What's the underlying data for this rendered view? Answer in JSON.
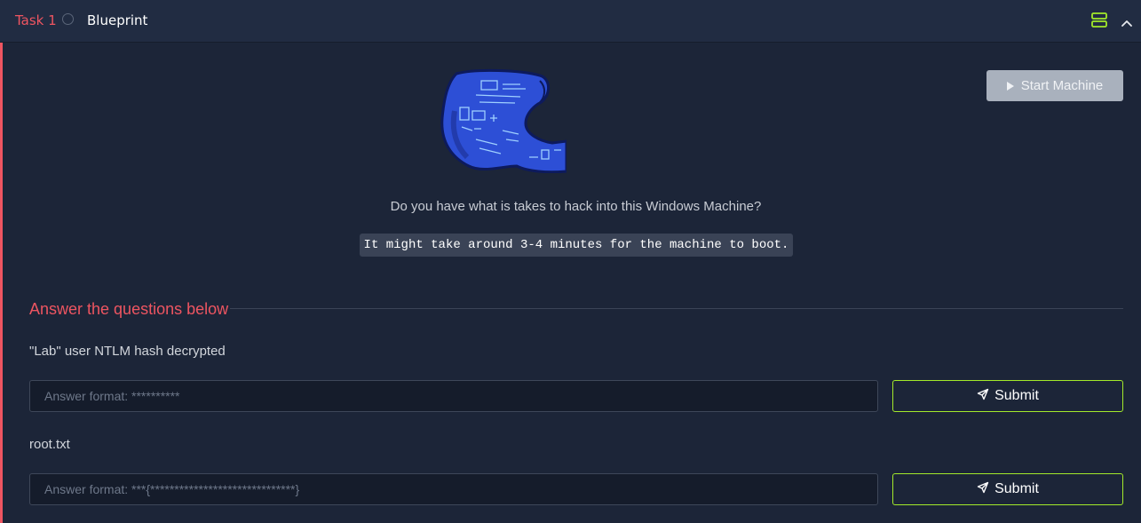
{
  "task": {
    "number_label": "Task 1",
    "title": "Blueprint"
  },
  "header_icons": {
    "vm": "server-stack-icon",
    "toggle": "chevron-up-icon"
  },
  "machine": {
    "start_label": "Start Machine",
    "image": "blueprint-scroll-illustration"
  },
  "content": {
    "description": "Do you have what is takes to hack into this Windows Machine?",
    "boot_note": "It might take around 3-4 minutes for the machine to boot."
  },
  "questions_heading": "Answer the questions below",
  "questions": [
    {
      "label": "\"Lab\" user NTLM hash decrypted",
      "placeholder": "Answer format: **********",
      "value": "",
      "submit_label": "Submit"
    },
    {
      "label": "root.txt",
      "placeholder": "Answer format: ***{******************************}",
      "value": "",
      "submit_label": "Submit"
    }
  ],
  "colors": {
    "accent_red": "#ee5561",
    "accent_green": "#a3ea2a",
    "background": "#1c2538",
    "header_background": "#212c42"
  }
}
